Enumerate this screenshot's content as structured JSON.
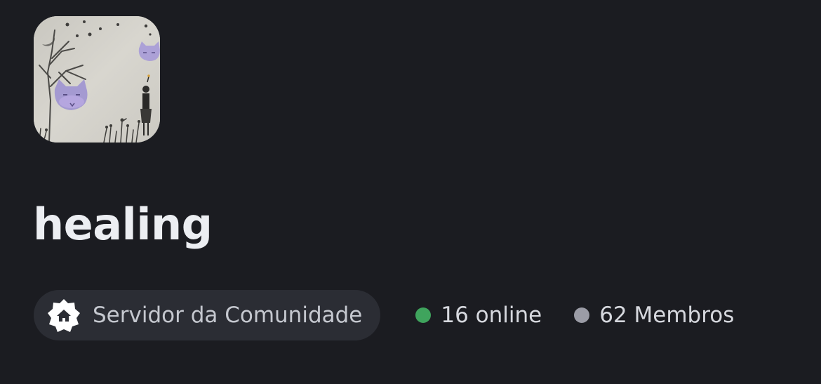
{
  "server": {
    "name": "healing",
    "icon": "server-avatar-illustration"
  },
  "badges": {
    "community_label": "Servidor da Comunidade",
    "community_icon": "community-house-badge-icon"
  },
  "stats": {
    "online_text": "16 online",
    "online_color": "#3fa45d",
    "members_text": "62 Membros",
    "members_color": "#9b9ca6"
  }
}
